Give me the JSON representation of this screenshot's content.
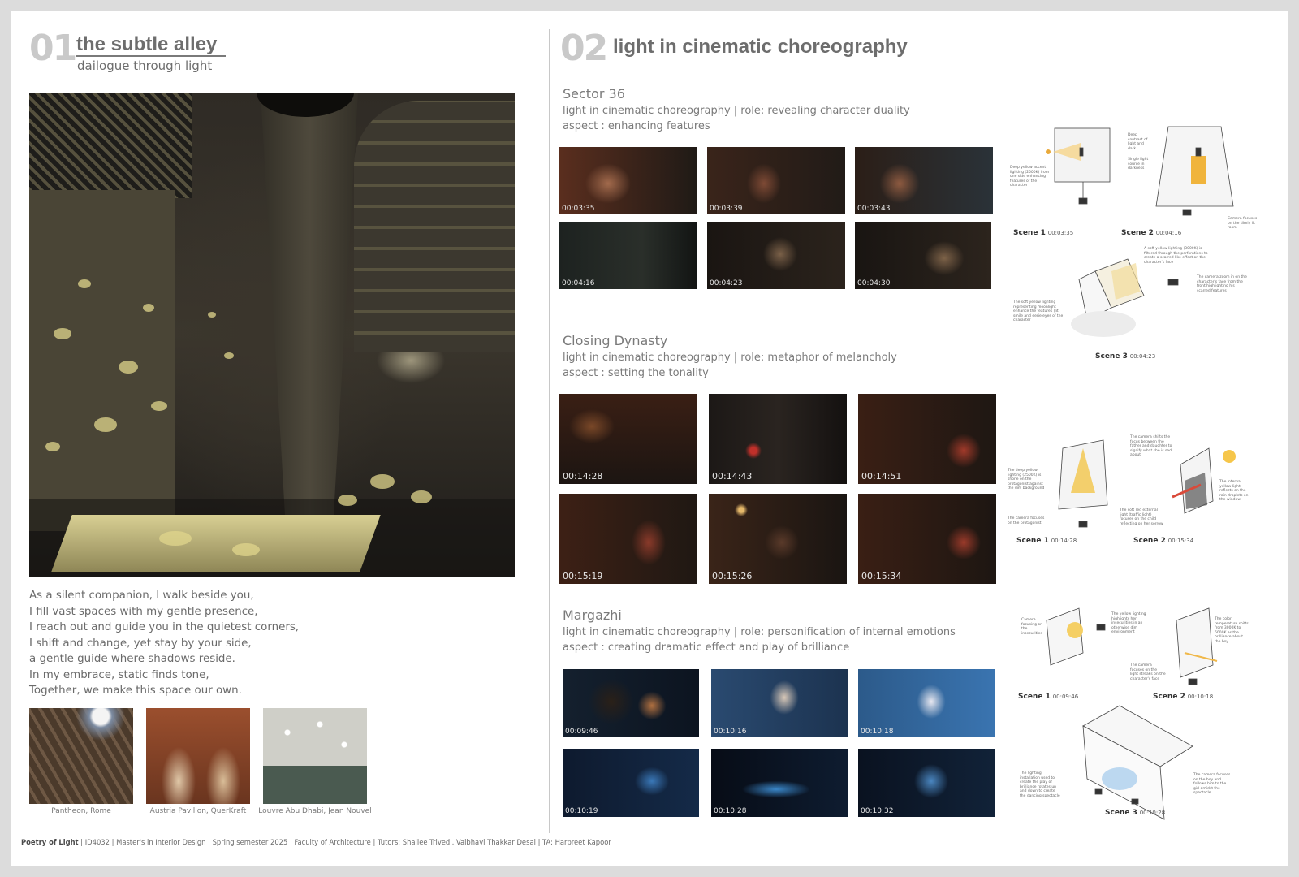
{
  "left": {
    "number": "01",
    "title": "the subtle alley",
    "subtitle": "dailogue through light",
    "poem": [
      "As a silent companion, I walk beside you,",
      "I fill vast spaces with my gentle presence,",
      "I reach out and guide you in the quietest corners,",
      "I shift and change, yet stay by your side,",
      "a gentle guide where shadows reside.",
      "In my embrace, static finds tone,",
      "Together, we make this space our own."
    ],
    "references": [
      {
        "caption": "Pantheon, Rome"
      },
      {
        "caption": "Austria Pavilion, QuerKraft"
      },
      {
        "caption": "Louvre Abu Dhabi, Jean Nouvel"
      }
    ],
    "footer_bold": "Poetry of Light",
    "footer_text": " | ID4032 | Master's in Interior Design | Spring semester 2025 | Faculty of Architecture | Tutors: Shailee Trivedi, Vaibhavi Thakkar Desai | TA: Harpreet Kapoor"
  },
  "right": {
    "number": "02",
    "title": "light in cinematic choreography",
    "films": [
      {
        "title": "Sector 36",
        "role": "light in cinematic choreography | role: revealing character duality",
        "aspect": "aspect : enhancing features",
        "timestamps": [
          "00:03:35",
          "00:03:39",
          "00:03:43",
          "00:04:16",
          "00:04:23",
          "00:04:30"
        ],
        "palette": [
          "#5a2e1e",
          "#2b2621",
          "#1a1411"
        ],
        "scenes": [
          {
            "label": "Scene 1",
            "time": "00:03:35"
          },
          {
            "label": "Scene 2",
            "time": "00:04:16"
          },
          {
            "label": "Scene 3",
            "time": "00:04:23"
          }
        ]
      },
      {
        "title": "Closing Dynasty",
        "role": "light in cinematic choreography | role: metaphor of melancholy",
        "aspect": "aspect : setting the tonality",
        "timestamps": [
          "00:14:28",
          "00:14:43",
          "00:14:51",
          "00:15:19",
          "00:15:26",
          "00:15:34"
        ],
        "palette": [
          "#3a1f14",
          "#1c1512",
          "#120e0c"
        ],
        "scenes": [
          {
            "label": "Scene 1",
            "time": "00:14:28"
          },
          {
            "label": "Scene 2",
            "time": "00:15:34"
          }
        ]
      },
      {
        "title": "Margazhi",
        "role": "light in cinematic choreography | role: personification of internal emotions",
        "aspect": "aspect : creating dramatic effect and play of brilliance",
        "timestamps": [
          "00:09:46",
          "00:10:16",
          "00:10:18",
          "00:10:19",
          "00:10:28",
          "00:10:32"
        ],
        "palette": [
          "#1f3a5c",
          "#0e1a2e",
          "#070c16"
        ],
        "scenes": [
          {
            "label": "Scene 1",
            "time": "00:09:46"
          },
          {
            "label": "Scene 2",
            "time": "00:10:18"
          },
          {
            "label": "Scene 3",
            "time": "00:10:28"
          }
        ]
      }
    ],
    "notes": {
      "s36_a": "Deep yellow accent lighting (2500K) from one side enhancing features of the character",
      "s36_b": "Deep contrast of light and dark",
      "s36_c": "Single light source in darkness",
      "s36_d": "Camera focuses on the dimly lit room",
      "s36_e": "A soft yellow lighting (3000K) is filtered through the perforations to create a scarred like effect on the character's face",
      "s36_f": "The camera zoom in on the character's face from the front highlighting his scarred features",
      "s36_g": "The soft yellow lighting representing moonlight enhance the features (lit) smile and eerie eyes of the character",
      "cd_a": "The deep yellow lighting (2500K) is shone on the protagonist against the dim background",
      "cd_b": "The camera focuses on the protagonist",
      "cd_c": "The camera shifts the focus between the father and daughter to signify what she is sad about",
      "cd_d": "The internal yellow light reflects on the rain droplets on the window",
      "cd_e": "The soft red external light (traffic light) focuses on the child reflecting on her sorrow",
      "mg_a": "Camera focusing on the insecurities",
      "mg_b": "The yellow lighting highlights her insecurities in an otherwise dim environment",
      "mg_c": "The color temperature shifts from 3000K to 6000K as the brilliance about the boy",
      "mg_d": "The camera focuses on the light streaks on the character's face",
      "mg_e": "The lighting installation used to create the play of brilliance rotates up and down to create the dancing spectacle",
      "mg_f": "The camera focuses on the boy and follows him to the girl amidst the spectacle"
    }
  }
}
